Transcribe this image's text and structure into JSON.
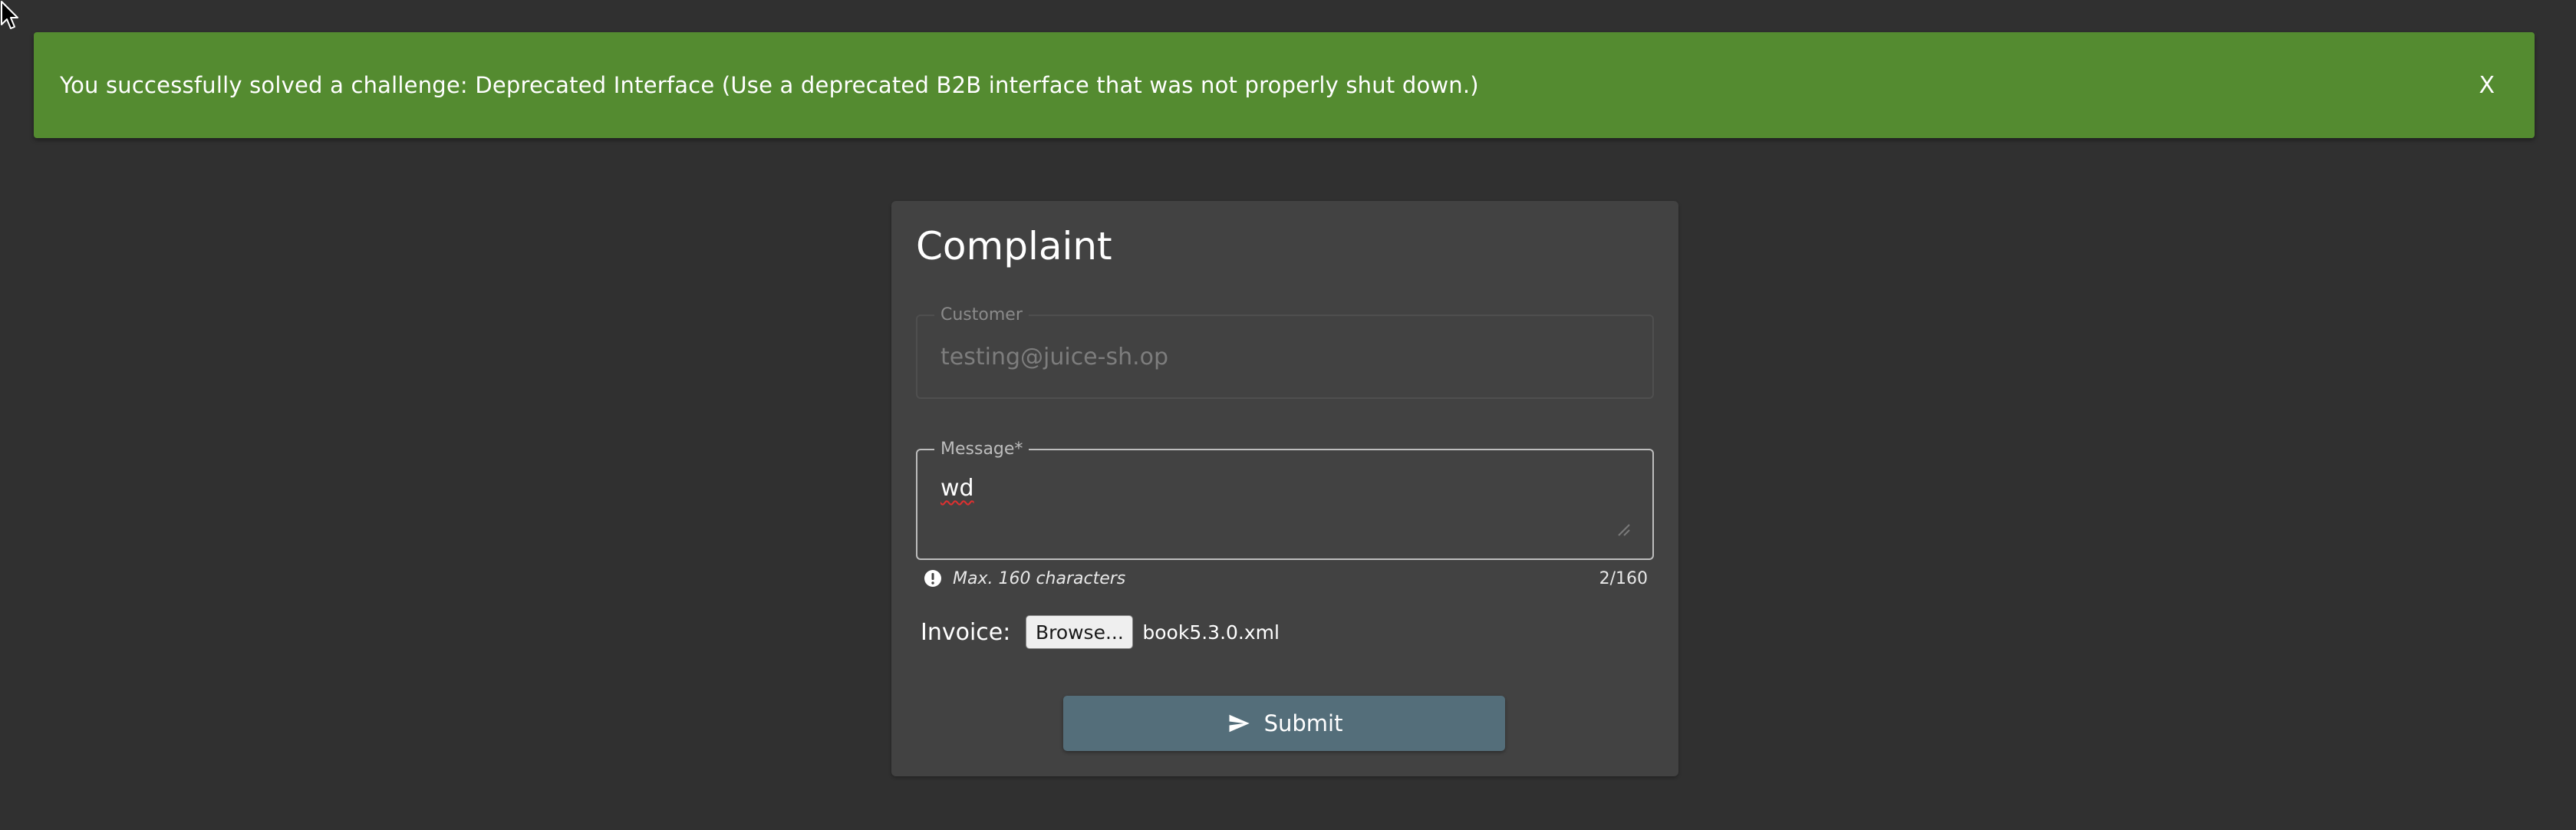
{
  "notification": {
    "message": "You successfully solved a challenge: Deprecated Interface (Use a deprecated B2B interface that was not properly shut down.)",
    "close_label": "X",
    "color": "#548b30"
  },
  "complaint": {
    "title": "Complaint",
    "customer": {
      "label": "Customer",
      "value": "testing@juice-sh.op"
    },
    "message": {
      "label": "Message*",
      "value": "wd",
      "hint": "Max. 160 characters",
      "counter": "2/160"
    },
    "invoice": {
      "label": "Invoice:",
      "browse_label": "Browse...",
      "file_name": "book5.3.0.xml"
    },
    "submit": {
      "label": "Submit",
      "icon": "send-icon",
      "color": "#546e7a"
    }
  },
  "colors": {
    "background": "#303030",
    "card": "#424242"
  }
}
